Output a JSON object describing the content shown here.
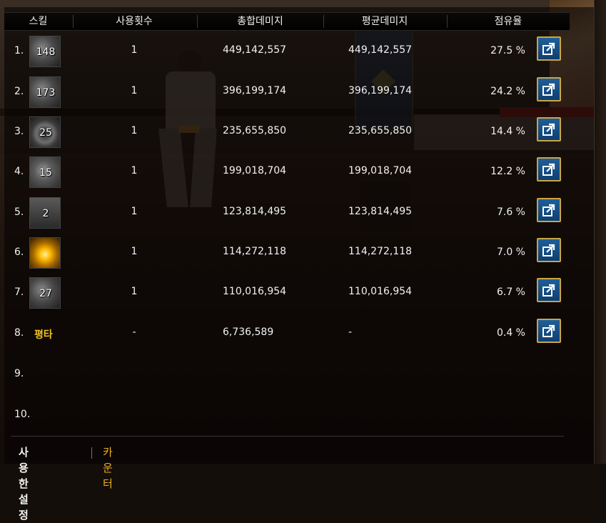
{
  "columns": [
    "스킬",
    "사용횟수",
    "총합데미지",
    "평균데미지",
    "점유율"
  ],
  "rows": [
    {
      "index": "1.",
      "skill_level": "148",
      "icon": "skill-icon-gray",
      "uses": "1",
      "total": "449,142,557",
      "average": "449,142,557",
      "share": "27.5 %"
    },
    {
      "index": "2.",
      "skill_level": "173",
      "icon": "skill-icon-gray",
      "uses": "1",
      "total": "396,199,174",
      "average": "396,199,174",
      "share": "24.2 %"
    },
    {
      "index": "3.",
      "skill_level": "25",
      "icon": "skill-icon-ring",
      "uses": "1",
      "total": "235,655,850",
      "average": "235,655,850",
      "share": "14.4 %"
    },
    {
      "index": "4.",
      "skill_level": "15",
      "icon": "skill-icon-fist",
      "uses": "1",
      "total": "199,018,704",
      "average": "199,018,704",
      "share": "12.2 %"
    },
    {
      "index": "5.",
      "skill_level": "2",
      "icon": "skill-icon-arch",
      "uses": "1",
      "total": "123,814,495",
      "average": "123,814,495",
      "share": "7.6 %"
    },
    {
      "index": "6.",
      "skill_level": "",
      "icon": "skill-icon-burst",
      "uses": "1",
      "total": "114,272,118",
      "average": "114,272,118",
      "share": "7.0 %"
    },
    {
      "index": "7.",
      "skill_level": "27",
      "icon": "skill-icon-gray",
      "uses": "1",
      "total": "110,016,954",
      "average": "110,016,954",
      "share": "6.7 %"
    },
    {
      "index": "8.",
      "label": "평타",
      "uses": "-",
      "total": "6,736,589",
      "average": "-",
      "share": "0.4 %"
    },
    {
      "index": "9."
    },
    {
      "index": "10."
    }
  ],
  "share_icon": "share-export-icon",
  "footer": {
    "active_tab": "사용한 설정",
    "tab": "카운터"
  },
  "colors": {
    "accent_gold": "#f0b020",
    "button_blue": "#1f5f99",
    "button_border": "#c9a645"
  }
}
